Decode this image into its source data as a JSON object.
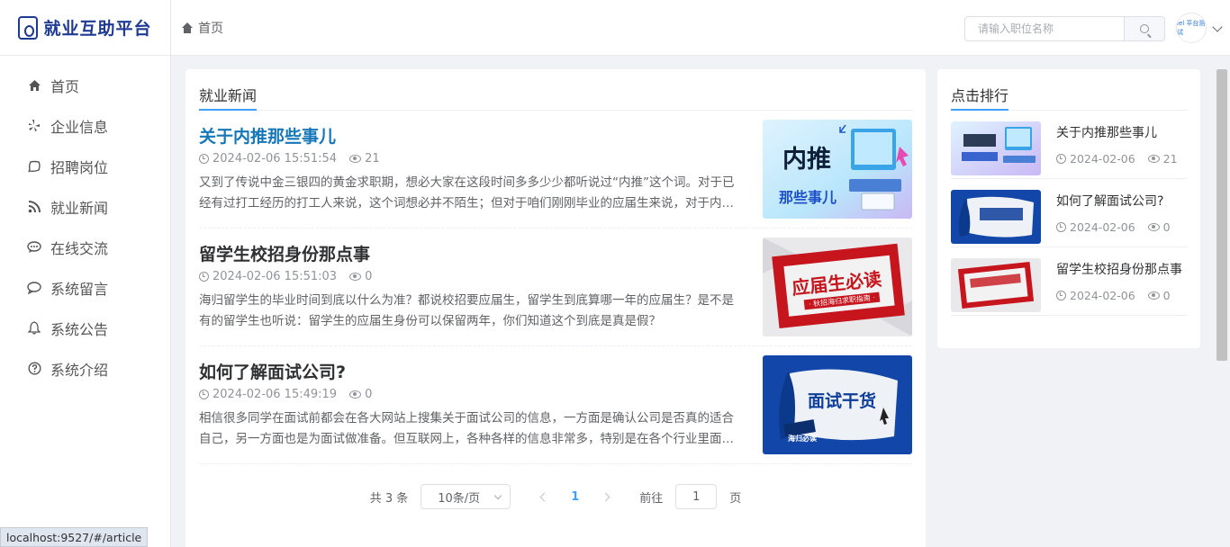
{
  "app": {
    "logo_text": "就业互助平台"
  },
  "sidebar": {
    "items": [
      {
        "label": "首页",
        "icon": "home-icon"
      },
      {
        "label": "企业信息",
        "icon": "yelp-icon"
      },
      {
        "label": "招聘岗位",
        "icon": "chat-bubble-icon"
      },
      {
        "label": "就业新闻",
        "icon": "rss-icon"
      },
      {
        "label": "在线交流",
        "icon": "comment-dots-icon"
      },
      {
        "label": "系统留言",
        "icon": "message-icon"
      },
      {
        "label": "系统公告",
        "icon": "bell-icon"
      },
      {
        "label": "系统介绍",
        "icon": "question-circle-icon"
      }
    ]
  },
  "header": {
    "breadcrumb": "首页",
    "search_placeholder": "请输入职位名称",
    "avatar_text": "lel 平台测试"
  },
  "main": {
    "section_title": "就业新闻",
    "articles": [
      {
        "title": "关于内推那些事儿",
        "date": "2024-02-06 15:51:54",
        "views": "21",
        "desc": "又到了传说中金三银四的黄金求职期，想必大家在这段时间多多少少都听说过“内推”这个词。对于已经有过打工经历的打工人来说，这个词想必并不陌生；但对于咱们刚刚毕业的应届生来说，对于内推的认识还有很多不足。",
        "thumb_main": "内推",
        "thumb_sub": "那些事儿"
      },
      {
        "title": "留学生校招身份那点事",
        "date": "2024-02-06 15:51:03",
        "views": "0",
        "desc": "海归留学生的毕业时间到底以什么为准？都说校招要应届生，留学生到底算哪一年的应届生？是不是有的留学生也听说：留学生的应届生身份可以保留两年，你们知道这个到底是真是假？",
        "thumb_main": "应届生必读",
        "thumb_sub": "· 秋招海归求职指南 ·"
      },
      {
        "title": "如何了解面试公司?",
        "date": "2024-02-06 15:49:19",
        "views": "0",
        "desc": "相信很多同学在面试前都会在各大网站上搜集关于面试公司的信息，一方面是确认公司是否真的适合自己，另一方面也是为面试做准备。但互联网上，各种各样的信息非常多，特别是在各个行业里面鱼龙混杂。",
        "thumb_main": "面试干货",
        "thumb_sub": "海归必读"
      }
    ],
    "pager": {
      "total": "共 3 条",
      "size": "10条/页",
      "current": "1",
      "goto_prefix": "前往",
      "goto_value": "1",
      "goto_suffix": "页"
    }
  },
  "ranking": {
    "title": "点击排行",
    "items": [
      {
        "title": "关于内推那些事儿",
        "date": "2024-02-06",
        "views": "21"
      },
      {
        "title": "如何了解面试公司?",
        "date": "2024-02-06",
        "views": "0"
      },
      {
        "title": "留学生校招身份那点事",
        "date": "2024-02-06",
        "views": "0"
      }
    ]
  },
  "status_url": "localhost:9527/#/article",
  "colors": {
    "accent": "#409eff",
    "brand": "#1f3a93",
    "title_active": "#1677b8"
  }
}
